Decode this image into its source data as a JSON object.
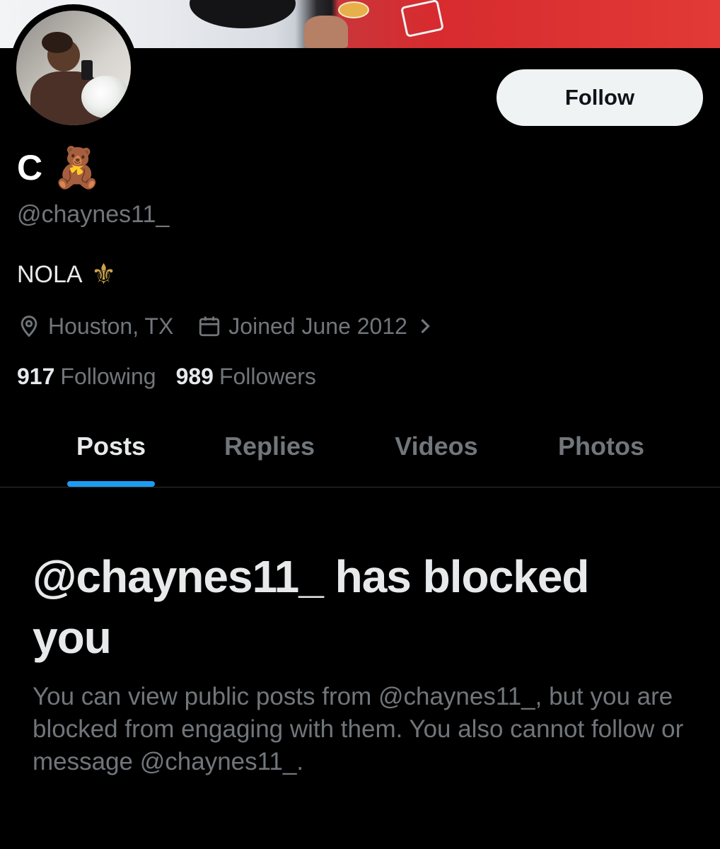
{
  "profile": {
    "display_name": "C",
    "name_emoji": "🧸",
    "handle": "@chaynes11_",
    "bio_text": "NOLA",
    "bio_emoji": "⚜",
    "location": "Houston, TX",
    "joined": "Joined June 2012",
    "following_count": "917",
    "following_label": "Following",
    "followers_count": "989",
    "followers_label": "Followers"
  },
  "actions": {
    "follow_label": "Follow"
  },
  "tabs": [
    {
      "label": "Posts",
      "active": true
    },
    {
      "label": "Replies",
      "active": false
    },
    {
      "label": "Videos",
      "active": false
    },
    {
      "label": "Photos",
      "active": false
    }
  ],
  "blocked": {
    "title": "@chaynes11_ has blocked you",
    "message": "You can view public posts from @chaynes11_, but you are blocked from engaging with them. You also cannot follow or message @chaynes11_."
  },
  "icons": {
    "location": "location-pin-icon",
    "calendar": "calendar-icon",
    "chevron": "chevron-right-icon"
  },
  "colors": {
    "background": "#000000",
    "primary_text": "#e7e9ea",
    "secondary_text": "#71767b",
    "accent": "#1d9bf0",
    "follow_button_bg": "#eff3f4"
  }
}
